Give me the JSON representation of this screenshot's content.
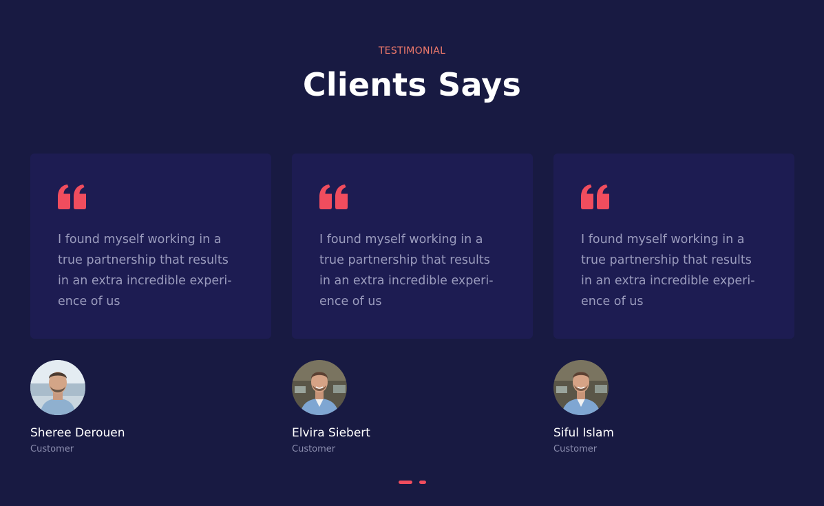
{
  "section": {
    "eyebrow": "TESTIMONIAL",
    "title": "Clients Says"
  },
  "colors": {
    "background": "#181a42",
    "card": "#1d1c52",
    "accent": "#f04d5e",
    "eyebrow": "#f07a6b"
  },
  "testimonials": [
    {
      "icon": "quote-icon",
      "text": "I found myself working in a true partnership that results in an extra incredible experi-ence of us",
      "name": "Sheree Derouen",
      "role": "Customer",
      "avatar": "avatar-photo"
    },
    {
      "icon": "quote-icon",
      "text": "I found myself working in a true partnership that results in an extra incredible experi-ence of us",
      "name": "Elvira Siebert",
      "role": "Customer",
      "avatar": "avatar-photo"
    },
    {
      "icon": "quote-icon",
      "text": "I found myself working in a true partnership that results in an extra incredible experi-ence of us",
      "name": "Siful Islam",
      "role": "Customer",
      "avatar": "avatar-photo"
    }
  ],
  "pagination": {
    "pages": 2,
    "active_index": 0
  }
}
